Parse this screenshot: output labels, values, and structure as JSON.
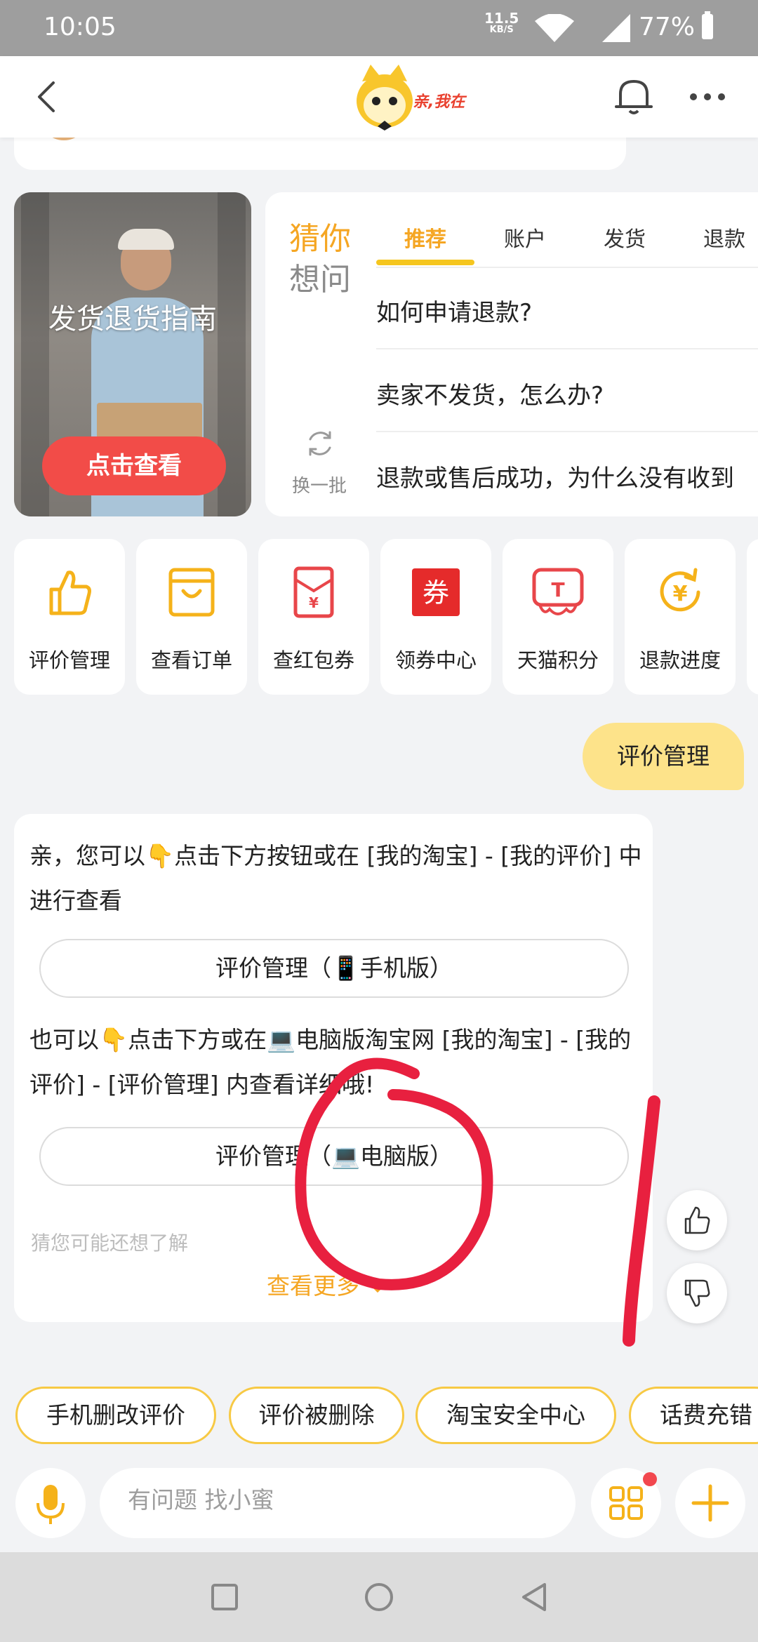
{
  "status_bar": {
    "time": "10:05",
    "net_speed": "11.5",
    "net_unit": "KB/S",
    "battery": "77%"
  },
  "header": {
    "logo_text": "亲,我在",
    "back_icon": "back-arrow-icon",
    "bell_icon": "bell-icon",
    "more_icon": "more-dots-icon"
  },
  "guide_card": {
    "title": "发货退货指南",
    "button": "点击查看"
  },
  "faq": {
    "heading_top": "猜你",
    "heading_bottom": "想问",
    "refresh_label": "换一批",
    "tabs": [
      "推荐",
      "账户",
      "发货",
      "退款"
    ],
    "active_tab": "推荐",
    "questions": [
      "如何申请退款?",
      "卖家不发货，怎么办?",
      "退款或售后成功，为什么没有收到"
    ]
  },
  "tools": [
    {
      "label": "评价管理",
      "icon": "thumbs-up-icon"
    },
    {
      "label": "查看订单",
      "icon": "order-bag-icon"
    },
    {
      "label": "查红包券",
      "icon": "red-packet-icon"
    },
    {
      "label": "领券中心",
      "icon": "coupon-icon",
      "icon_text": "券"
    },
    {
      "label": "天猫积分",
      "icon": "tmall-points-icon"
    },
    {
      "label": "退款进度",
      "icon": "refund-progress-icon"
    }
  ],
  "user_message": "评价管理",
  "answer": {
    "paragraph1": "亲，您可以👇点击下方按钮或在 [我的淘宝] - [我的评价] 中进行查看",
    "button_mobile": "评价管理（📱手机版）",
    "paragraph2": "也可以👇点击下方或在💻电脑版淘宝网 [我的淘宝] - [我的评价] - [评价管理] 内查看详细哦!",
    "button_pc": "评价管理（💻电脑版）",
    "hint": "猜您可能还想了解",
    "more": "查看更多"
  },
  "chips": [
    "手机删改评价",
    "评价被删除",
    "淘宝安全中心",
    "话费充错"
  ],
  "input": {
    "placeholder": "有问题 找小蜜"
  },
  "colors": {
    "accent": "#f5a623",
    "yellow": "#f5c61f",
    "red": "#f24c48",
    "bubble": "#fde38a",
    "annotation": "#e8203f"
  }
}
